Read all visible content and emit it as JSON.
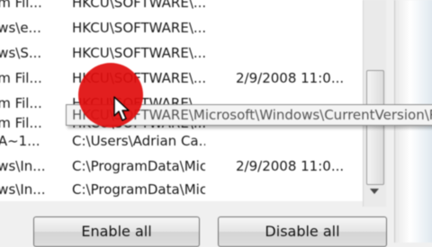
{
  "list": {
    "rows": [
      {
        "name": "am Fil...",
        "location": "HKCU\\SOFTWARE\\...",
        "modified": ""
      },
      {
        "name": "ows\\e...",
        "location": "HKCU\\SOFTWARE\\...",
        "modified": ""
      },
      {
        "name": "ows\\S...",
        "location": "HKCU\\SOFTWARE\\...",
        "modified": ""
      },
      {
        "name": "am Fil...",
        "location": "HKCU\\SOFTWARE\\...",
        "modified": "2/9/2008 11:0..."
      },
      {
        "name": "am Fil...",
        "location": "HKCU\\SOFTWARE\\...",
        "modified": ""
      },
      {
        "name": "am Fil...",
        "location": "HKCU\\SOFTWARE\\...",
        "modified": ""
      },
      {
        "name": "RA~1...",
        "location": "C:\\Users\\Adrian Ca...",
        "modified": ""
      },
      {
        "name": "ows\\In...",
        "location": "C:\\ProgramData\\Mic...",
        "modified": "2/9/2008 11:0..."
      },
      {
        "name": "ows\\In...",
        "location": "C:\\ProgramData\\Mic...",
        "modified": ""
      }
    ]
  },
  "tooltip": {
    "text": "HKCU\\SOFTWARE\\Microsoft\\Windows\\CurrentVersion\\R"
  },
  "buttons": {
    "enable_label": "Enable all",
    "disable_label": "Disable all"
  },
  "colors": {
    "cursor_highlight": "#e00e0e"
  }
}
